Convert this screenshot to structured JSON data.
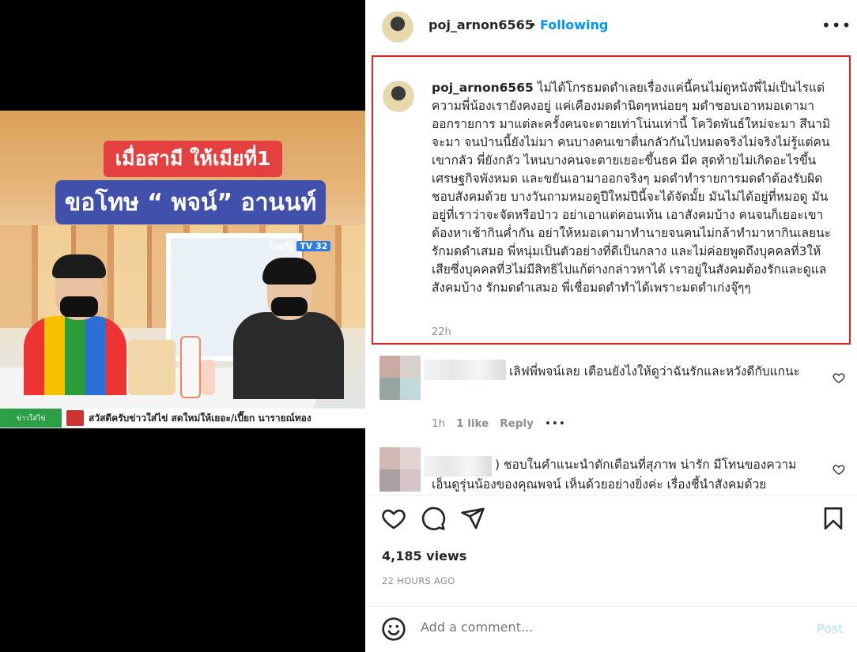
{
  "media": {
    "overlay_line1": "เมื่อสามี ให้เมียที่1",
    "overlay_line2": "ขอโทษ “ พจน์” อานนท์",
    "channel": "ไทยรัฐ",
    "channel_num": "TV 32",
    "ticker_left": "ข่าวใส่ไข่",
    "ticker_text": "สวัสดีครับข่าวใส่ไข่ สดใหม่ให้เยอะ/เปี๊ยก นารายณ์ทอง"
  },
  "header": {
    "username": "poj_arnon6565",
    "separator": "•",
    "follow_label": "Following",
    "more_label": "•••"
  },
  "caption": {
    "username": "poj_arnon6565",
    "text": "ไม่ได้โกรธมดดำเลยเรื่องแค่นี้คนไม่ดูหนังพี่ไม่เป็นไรแต่ความพี่น้องเรายังคงอยู่ แค่เคืองมดดำนิดๆหน่อยๆ มดำชอบเอาหมอเดามาออกรายการ มาแต่ละครั้งคนจะตายเท่าโน่นเท่านี้ โควิดพันธ์ใหม่จะมา สึนามิจะมา จนป่านนี้ยังไม่มา คนบางคนเขาตื่นกลัวกันไปหมดจริงไม่จริงไม่รู้แต่คนเขากลัว พี่ยังกลัว ไหนบางคนจะตายเยอะขึ้นธค มีค สุดท้ายไม่เกิดอะไรขึ้นเศรษฐกิจพังหมด และขยันเอามาออกจริงๆ มดดำทำรายการมดดำต้องรับผิดชอบสังคมด้วย บางวันถามหมอดูปีใหม่ปีนี้จะได้จัดมั้ย มันไม่ได้อยู่ที่หมอดู มันอยู่ที่เราว่าจะจัดหรือป่าว อย่าเอาแต่คอนเท้น เอาสังคมบ้าง คนจนก็เยอะเขาต้องหาเช้ากินค่ำกัน อย่าให้หมอเดามาทำนายจนคนไม่กล้าทำมาหากินเลยนะ รักมดดำเสมอ พี่หนุ่มเป็นตัวอย่างที่ดีเป็นกลาง และไม่ค่อยพูดถึงบุคคลที่3ให้เสียซึ่งบุคคลที่3ไม่มีสิทธิไปแก้ต่างกล่าวหาได้ เราอยู่ในสังคมต้องรักและดูแลสังคมบ้าง รักมดดำเสมอ พี่เชื่อมดดำทำได้เพราะมดดำเก่งจุ๊ๆๆ",
    "time": "22h"
  },
  "comments": [
    {
      "text": "เลิฟพี่พจน์เลย เตือนยังไงให้ดูว่าฉันรักและหวังดีกับแกนะ",
      "time": "1h",
      "likes": "1 like",
      "reply": "Reply",
      "more": "•••",
      "avatar_colors": [
        "#c9aba1",
        "#d8d2cd",
        "#96a5a2",
        "#c1d9dc"
      ]
    },
    {
      "text_prefix": ")",
      "text": "ชอบในคำแนะนำตักเตือนที่สุภาพ น่ารัก มีโทนของความเอ็นดูรุ่นน้องของคุณพจน์ เห็นด้วยอย่างยิ่งค่ะ เรื่องชี้นำสังคมด้วย",
      "avatar_colors": [
        "#d2b8b3",
        "#e2d4d1",
        "#a9a0a2",
        "#d7c4c6"
      ]
    }
  ],
  "stats": {
    "views": "4,185 views",
    "posted_ago": "22 HOURS AGO"
  },
  "add_comment": {
    "placeholder": "Add a comment...",
    "post_label": "Post"
  },
  "colors": {
    "accent": "#0095f6",
    "highlight_border": "#e02020",
    "muted": "#8e8e8e",
    "post_disabled": "#b2dffc"
  },
  "icons": [
    "heart-icon",
    "comment-icon",
    "share-icon",
    "bookmark-icon",
    "emoji-icon"
  ]
}
